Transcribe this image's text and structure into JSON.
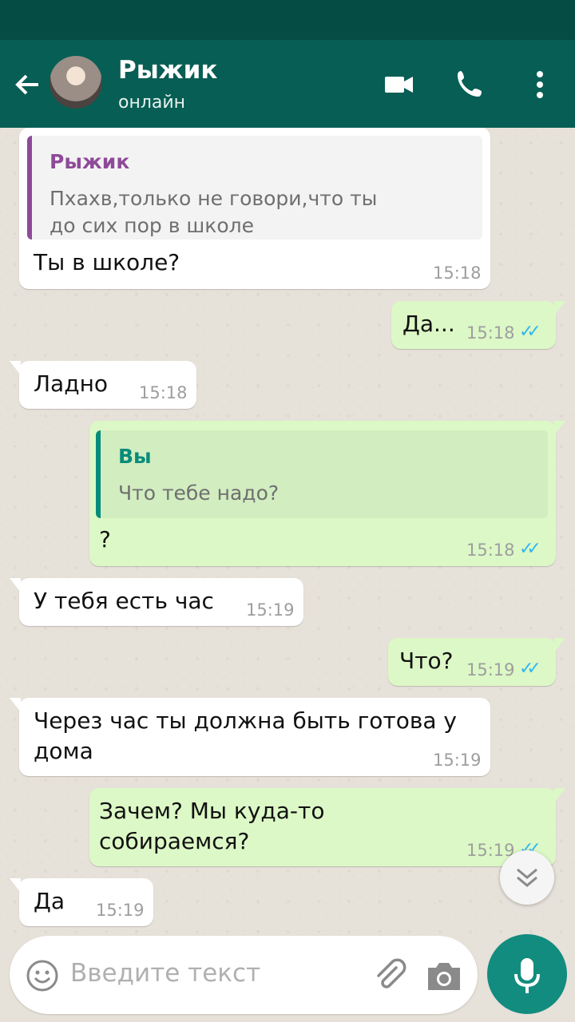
{
  "header": {
    "contact_name": "Рыжик",
    "contact_status": "онлайн",
    "icons": [
      "back-arrow-icon",
      "avatar",
      "video-call-icon",
      "phone-icon",
      "more-vert-icon"
    ]
  },
  "messages": [
    {
      "direction": "in",
      "quote": {
        "name": "Рыжик",
        "text_line1": "Пхахв,только не говори,что ты",
        "text_line2": "до сих пор в школе"
      },
      "text": "Ты в школе?",
      "time": "15:18"
    },
    {
      "direction": "out",
      "text": "Да...",
      "time": "15:18",
      "read": true
    },
    {
      "direction": "in",
      "text": "Ладно",
      "time": "15:18"
    },
    {
      "direction": "out",
      "quote": {
        "name": "Вы",
        "text_line1": "Что тебе надо?"
      },
      "text": "?",
      "time": "15:18",
      "read": true
    },
    {
      "direction": "in",
      "text": "У тебя есть час",
      "time": "15:19"
    },
    {
      "direction": "out",
      "text": "Что?",
      "time": "15:19",
      "read": true
    },
    {
      "direction": "in",
      "text_line1": "Через час ты должна быть готова у",
      "text_line2": "дома",
      "time": "15:19"
    },
    {
      "direction": "out",
      "text_line1": "Зачем? Мы куда-то",
      "text_line2": "собираемся?",
      "time": "15:19",
      "read": true
    },
    {
      "direction": "in",
      "text": "Да",
      "time": "15:19"
    }
  ],
  "input": {
    "placeholder": "Введите текст"
  },
  "colors": {
    "header": "#075e54",
    "status_bar": "#054d44",
    "outgoing": "#dcf8c6",
    "incoming": "#ffffff",
    "accent": "#128c7e",
    "read_ticks": "#34b7f1"
  }
}
